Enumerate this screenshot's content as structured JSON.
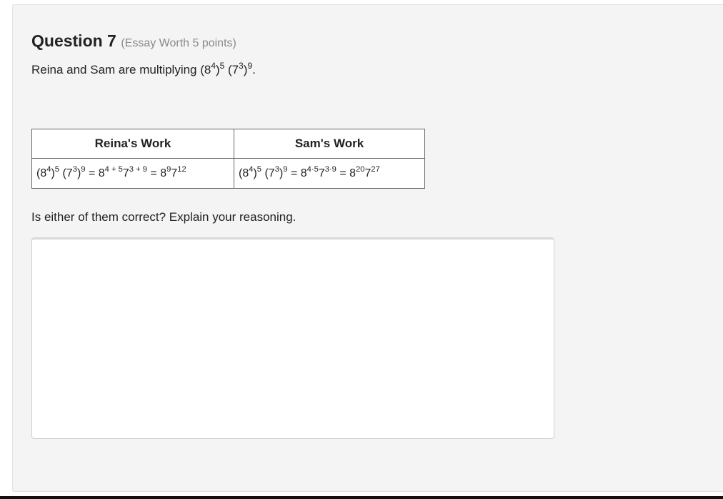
{
  "question": {
    "title": "Question 7",
    "meta": "(Essay Worth 5 points)",
    "prompt": {
      "lead": "Reina and Sam are multiplying",
      "b1": "(8",
      "e1": "4",
      "b2": ")",
      "e2": "5",
      "b3": " (7",
      "e3": "3",
      "b4": ")",
      "e4": "9",
      "end": "."
    }
  },
  "table": {
    "headers": [
      "Reina's Work",
      "Sam's Work"
    ],
    "reina": [
      {
        "t": "(8"
      },
      {
        "s": "4"
      },
      {
        "t": ")"
      },
      {
        "s": "5"
      },
      {
        "t": " (7"
      },
      {
        "s": "3"
      },
      {
        "t": ")"
      },
      {
        "s": "9"
      },
      {
        "t": " = 8"
      },
      {
        "s": "4 + 5"
      },
      {
        "t": "7"
      },
      {
        "s": "3 + 9"
      },
      {
        "t": " = 8"
      },
      {
        "s": "9"
      },
      {
        "t": "7"
      },
      {
        "s": "12"
      }
    ],
    "sam": [
      {
        "t": "(8"
      },
      {
        "s": "4"
      },
      {
        "t": ")"
      },
      {
        "s": "5"
      },
      {
        "t": " (7"
      },
      {
        "s": "3"
      },
      {
        "t": ")"
      },
      {
        "s": "9"
      },
      {
        "t": " = 8"
      },
      {
        "s": "4·5"
      },
      {
        "t": "7"
      },
      {
        "s": "3·9"
      },
      {
        "t": " = 8"
      },
      {
        "s": "20"
      },
      {
        "t": "7"
      },
      {
        "s": "27"
      }
    ]
  },
  "followup": "Is either of them correct? Explain your reasoning.",
  "answer": {
    "value": "",
    "placeholder": ""
  }
}
